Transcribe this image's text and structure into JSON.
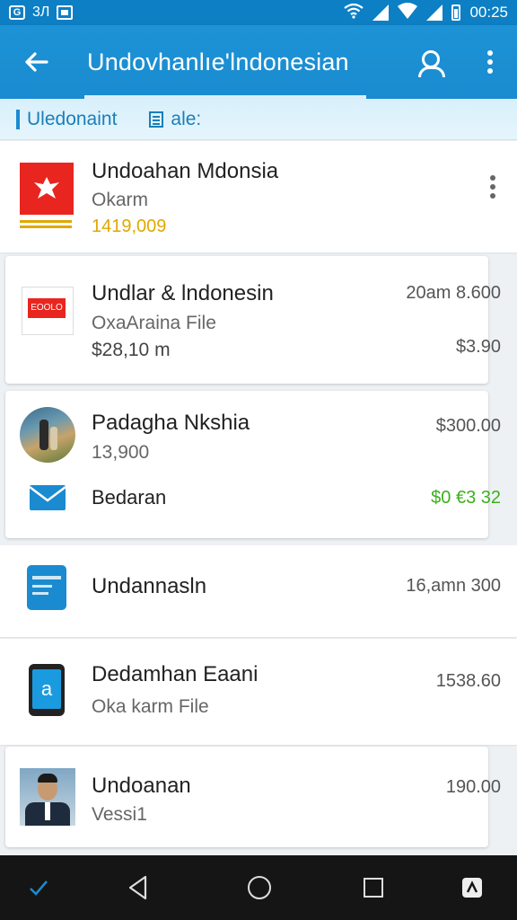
{
  "status_bar": {
    "left_text": "3Л",
    "time": "00:25"
  },
  "app_bar": {
    "title": "Undovhanlıe'lndonesian",
    "back_icon": "arrow-left-icon",
    "search_icon": "person-search-icon",
    "menu_icon": "more-vertical-icon"
  },
  "sub_bar": {
    "label": "Uledonaint",
    "label2": "ale:"
  },
  "items": [
    {
      "title": "Undoahan Mdonsia",
      "subtitle": "Okarm",
      "value": "1419,009",
      "icon": "indonesia-emblem-icon"
    },
    {
      "title": "Undlar & lndonesin",
      "subtitle": "OxaAraina File",
      "value": "$28,10 m",
      "time": "20am 8.600",
      "amount": "$3.90",
      "icon": "red-label-icon"
    },
    {
      "title": "Padagha Nkshia",
      "subtitle": "13,900",
      "time": "$300.00",
      "secondary_title": "Bedaran",
      "amount": "$0 €3 32",
      "icon": "photo-avatar-icon",
      "secondary_icon": "mail-icon"
    },
    {
      "title": "Undannasln",
      "time": "16,amn 300",
      "icon": "card-app-icon"
    },
    {
      "title": "Dedamhan Eaani",
      "subtitle": "Oka karm File",
      "time": "1538.60",
      "icon": "phone-app-icon"
    },
    {
      "title": "Undoanan",
      "subtitle": "Vessi1",
      "time": "190.00",
      "icon": "person-photo-icon"
    }
  ],
  "nav_bar": {
    "check_icon": "check-icon",
    "back_icon": "nav-back-icon",
    "home_icon": "nav-home-icon",
    "recents_icon": "nav-recents-icon",
    "extra_icon": "screen-rotate-icon"
  },
  "colors": {
    "primary": "#1a8bd0",
    "accent_orange": "#e0a800",
    "accent_green": "#3cb01c"
  }
}
